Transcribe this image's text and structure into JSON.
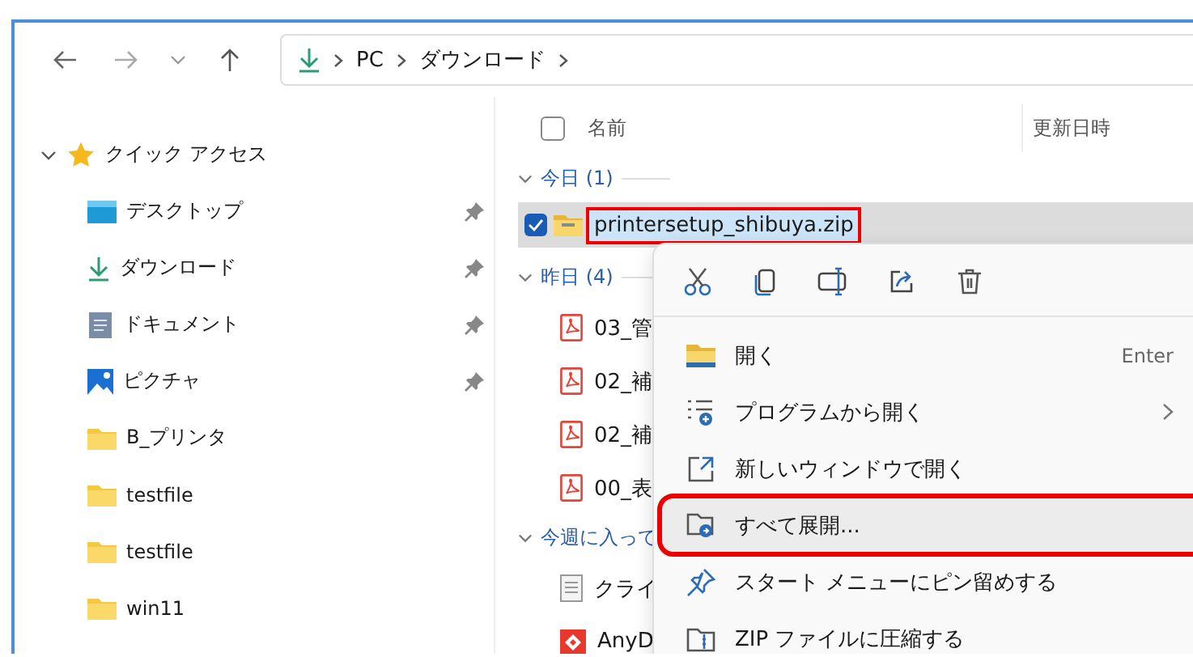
{
  "address_bar": {
    "path": [
      "PC",
      "ダウンロード"
    ]
  },
  "sidebar": {
    "header": {
      "label": "クイック アクセス",
      "expanded": true
    },
    "items": [
      {
        "label": "デスクトップ",
        "kind": "desktop",
        "pinned": true
      },
      {
        "label": "ダウンロード",
        "kind": "download",
        "pinned": true
      },
      {
        "label": "ドキュメント",
        "kind": "document",
        "pinned": true
      },
      {
        "label": "ピクチャ",
        "kind": "picture",
        "pinned": true
      },
      {
        "label": "B_プリンタ",
        "kind": "folder",
        "pinned": false
      },
      {
        "label": "testfile",
        "kind": "folder",
        "pinned": false
      },
      {
        "label": "testfile",
        "kind": "folder",
        "pinned": false
      },
      {
        "label": "win11",
        "kind": "folder",
        "pinned": false
      }
    ]
  },
  "select_all": {
    "checked": false
  },
  "columns": [
    "名前",
    "更新日時"
  ],
  "groups": [
    {
      "label": "今日 (1)",
      "expanded": true,
      "files": [
        {
          "name": "printersetup_shibuya.zip",
          "kind": "zip",
          "selected": true,
          "annotated": true
        }
      ]
    },
    {
      "label": "昨日 (4)",
      "expanded": true,
      "files": [
        {
          "name": "03_管",
          "kind": "pdf",
          "selected": false,
          "annotated": false
        },
        {
          "name": "02_補",
          "kind": "pdf",
          "selected": false,
          "annotated": false
        },
        {
          "name": "02_補",
          "kind": "pdf",
          "selected": false,
          "annotated": false
        },
        {
          "name": "00_表",
          "kind": "pdf",
          "selected": false,
          "annotated": false
        }
      ]
    },
    {
      "label": "今週に入って",
      "expanded": true,
      "files": [
        {
          "name": "クライ",
          "kind": "text",
          "selected": false,
          "annotated": false
        },
        {
          "name": "AnyD",
          "kind": "app",
          "selected": false,
          "annotated": false
        }
      ]
    }
  ],
  "context_menu": {
    "actions": [
      {
        "kind": "cut"
      },
      {
        "kind": "copy"
      },
      {
        "kind": "rename"
      },
      {
        "kind": "share"
      },
      {
        "kind": "delete"
      }
    ],
    "items": [
      {
        "label": "開く",
        "kind": "open",
        "shortcut": "Enter",
        "submenu": false,
        "highlighted": false,
        "annotated": false
      },
      {
        "label": "プログラムから開く",
        "kind": "openwith",
        "submenu": true,
        "highlighted": false,
        "annotated": false
      },
      {
        "label": "新しいウィンドウで開く",
        "kind": "newwindow",
        "submenu": false,
        "highlighted": false,
        "annotated": false
      },
      {
        "label": "すべて展開...",
        "kind": "extract",
        "submenu": false,
        "highlighted": true,
        "annotated": true
      },
      {
        "label": "スタート メニューにピン留めする",
        "kind": "pin",
        "submenu": false,
        "highlighted": false,
        "annotated": false
      },
      {
        "label": "ZIP ファイルに圧縮する",
        "kind": "zip",
        "submenu": false,
        "highlighted": false,
        "annotated": false
      }
    ]
  }
}
